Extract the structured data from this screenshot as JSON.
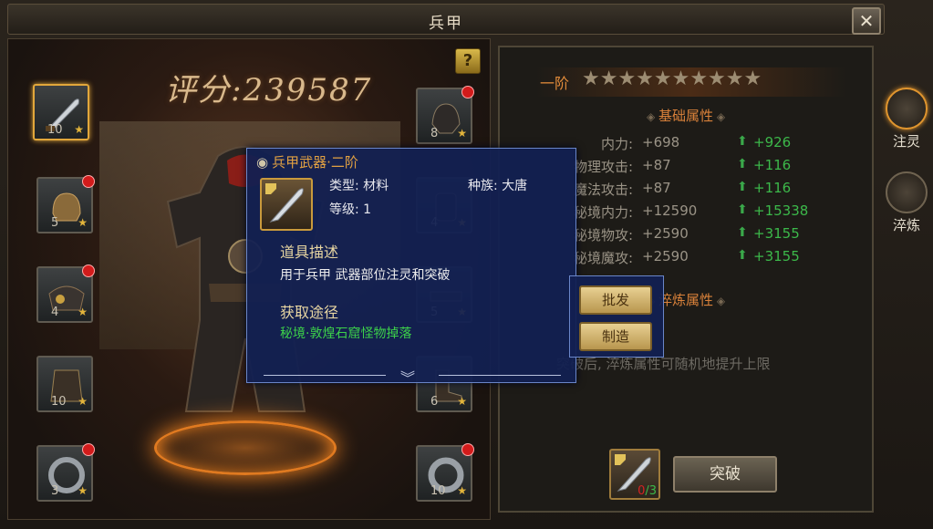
{
  "window": {
    "title": "兵甲",
    "close_label": "✕"
  },
  "score": {
    "text": "评分:239587"
  },
  "help_label": "?",
  "slots_left": [
    {
      "level": "10",
      "icon": "blade-icon",
      "selected": true,
      "badge": false
    },
    {
      "level": "5",
      "icon": "helmet-icon",
      "selected": false,
      "badge": true
    },
    {
      "level": "4",
      "icon": "shoulder-armor-icon",
      "selected": false,
      "badge": true
    },
    {
      "level": "10",
      "icon": "chest-armor-icon",
      "selected": false,
      "badge": false
    },
    {
      "level": "3",
      "icon": "ring-icon",
      "selected": false,
      "badge": true
    }
  ],
  "slots_right": [
    {
      "level": "8",
      "icon": "beast-helm-icon",
      "badge": true
    },
    {
      "level": "4",
      "icon": "gauntlet-icon",
      "badge": false
    },
    {
      "level": "5",
      "icon": "belt-icon",
      "badge": false
    },
    {
      "level": "6",
      "icon": "boots-icon",
      "badge": false
    },
    {
      "level": "10",
      "icon": "bracelet-icon",
      "badge": true
    }
  ],
  "attributes": {
    "rank_label": "一阶",
    "stars": "★★★★★★★★★★",
    "base_title": "基础属性",
    "stats": [
      {
        "name": "内力:",
        "value": "+698",
        "increase": "+926"
      },
      {
        "name": "物理攻击:",
        "value": "+87",
        "increase": "+116"
      },
      {
        "name": "魔法攻击:",
        "value": "+87",
        "increase": "+116"
      },
      {
        "name": "秘境内力:",
        "value": "+12590",
        "increase": "+15338"
      },
      {
        "name": "秘境物攻:",
        "value": "+2590",
        "increase": "+3155"
      },
      {
        "name": "秘境魔攻:",
        "value": "+2590",
        "increase": "+3155"
      }
    ],
    "refine_title": "淬炼属性",
    "refine_hint": "突破后, 淬炼属性可随机地提升上限",
    "material_need": "0",
    "material_have": "/3",
    "break_label": "突破"
  },
  "side_tabs": [
    {
      "label": "注灵",
      "icon": "infuse-icon",
      "active": true
    },
    {
      "label": "淬炼",
      "icon": "refine-icon",
      "active": false
    }
  ],
  "tooltip": {
    "title": "兵甲武器·二阶",
    "type_label": "类型:",
    "type_value": "材料",
    "race_label": "种族:",
    "race_value": "大唐",
    "level_label": "等级:",
    "level_value": "1",
    "desc_title": "道具描述",
    "desc_text": "用于兵甲 武器部位注灵和突破",
    "source_title": "获取途径",
    "source_text": "秘境·敦煌石窟怪物掉落"
  },
  "context_menu": {
    "wholesale_label": "批发",
    "craft_label": "制造"
  }
}
